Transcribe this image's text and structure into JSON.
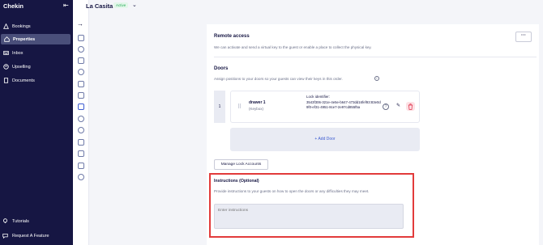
{
  "sidebar": {
    "brand": "Chekin",
    "items": [
      {
        "label": "Bookings",
        "icon": "suitcase-icon"
      },
      {
        "label": "Properties",
        "icon": "home-icon",
        "active": true
      },
      {
        "label": "Inbox",
        "icon": "inbox-icon"
      },
      {
        "label": "Upselling",
        "icon": "upselling-icon"
      },
      {
        "label": "Documents",
        "icon": "document-icon"
      }
    ],
    "bottom": [
      {
        "label": "Tutorials",
        "icon": "bulb-icon"
      },
      {
        "label": "Request A Feature",
        "icon": "chat-icon"
      }
    ]
  },
  "header": {
    "title": "La Casita",
    "status": "Active"
  },
  "remote_access": {
    "title": "Remote access",
    "description": "We can activate and send a virtual key to the guest or enable a place to collect the physical key."
  },
  "doors": {
    "title": "Doors",
    "description": "Assign positions to your doors so your guests can view their keys in this order.",
    "items": [
      {
        "position": "1",
        "name": "drawer 1",
        "type": "(Keybox)",
        "lock_label": "Lock identifier:",
        "lock_id": "3543f306-321e-4e5e-b647-473dd16fef93:83e0d9f0-ef31-4951-8ce7-2e97cd855f5a"
      }
    ],
    "add_label": "+ Add Door"
  },
  "manage_label": "Manage Lock Accounts",
  "instructions": {
    "title": "Instructions (Optional)",
    "description": "Provide instructions to your guests on how to open the doors or any difficulties they may meet.",
    "placeholder": "Enter instructions"
  },
  "colors": {
    "sidebar": "#161643",
    "accent": "#3c5bd1",
    "highlight": "#e23b3b",
    "active_badge": "#2bae5c",
    "danger": "#e0304a"
  }
}
